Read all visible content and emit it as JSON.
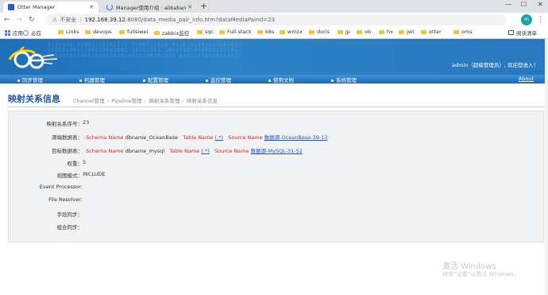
{
  "browser": {
    "tabs": [
      {
        "title": "Otter Manager",
        "active": true
      },
      {
        "title": "Manager使用介绍 · alibaba/ott",
        "active": false
      }
    ],
    "insecure_label": "不安全",
    "url_host": "192.168.39.12",
    "url_path": ":8080/data_media_pair_info.htm?dataMediaPairId=23",
    "profile_initial": "m",
    "bookmarks": [
      "应用",
      "必应",
      "Links",
      "devops",
      "fulisiwei",
      "zabbix监控",
      "sqc",
      "Full-stack",
      "k8s",
      "wmzx",
      "doris",
      "jp",
      "ob",
      "hx",
      "jwt",
      "otter",
      "oms"
    ],
    "reading_list": "阅读清单"
  },
  "header": {
    "user_prefix": "admin（超级管理员）,",
    "user_suffix": "欢迎您进入！",
    "nav": [
      "同步管理",
      "机器管理",
      "配置管理",
      "监控管理",
      "使用文档",
      "系统管理"
    ],
    "about": "About"
  },
  "page": {
    "title": "映射关系信息",
    "breadcrumbs": [
      "Channel管理",
      "Pipeline管理",
      "映射关系管理",
      "映射关系信息"
    ]
  },
  "details": {
    "id_label": "映射关系序号：",
    "id_value": "23",
    "source_label": "源端数据表：",
    "source": {
      "schema_key": "Schema Name",
      "schema_val": "dbname_OceanBase",
      "table_key": "Table Name",
      "table_val": "(.*)",
      "src_key": "Source Name",
      "src_val": "数据源-OceanBase-39-13"
    },
    "target_label": "目标数据表：",
    "target": {
      "schema_key": "Schema Name",
      "schema_val": "dbname_mysql",
      "table_key": "Table Name",
      "table_val": "(.*)",
      "src_key": "Source Name",
      "src_val": "数据源-MySQL-31-52"
    },
    "weight_label": "权重：",
    "weight_value": "5",
    "mode_label": "视图模式：",
    "mode_value": "INCLUDE",
    "event_label": "Event Processor:",
    "resolver_label": "File Resolver:",
    "field_label": "字段同步：",
    "group_label": "组合同步："
  },
  "watermark": {
    "line1": "激活 Windows",
    "line2": "转到“设置”以激活 Windows。"
  }
}
